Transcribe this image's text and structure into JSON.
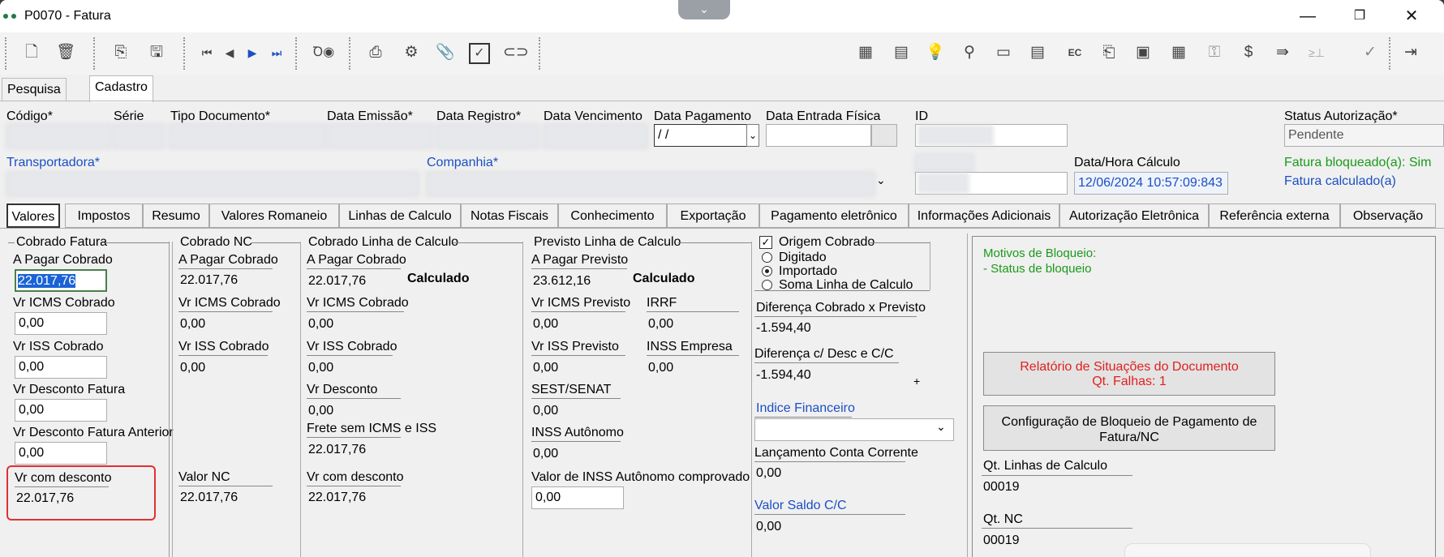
{
  "window": {
    "title": "P0070 - Fatura",
    "minimize": "—",
    "restore": "❐",
    "close": "✕",
    "collapse": "⌄"
  },
  "toolbar": {
    "icons": [
      "new-icon",
      "delete-icon",
      "copy-icon",
      "save-icon",
      "first-icon",
      "prev-icon",
      "next-icon",
      "last-icon",
      "search-binoculars-icon",
      "print-icon",
      "settings-icon",
      "attach-icon",
      "confirm-icon",
      "link-icon",
      "calculator-icon",
      "spreadsheet-icon",
      "bulb-icon",
      "tree-icon",
      "card-icon",
      "document-icon",
      "ec-icon",
      "export-icon",
      "sheet-check-icon",
      "calculator-grid-icon",
      "key-icon",
      "money-icon",
      "transfer-icon",
      "code-icon",
      "check-icon",
      "exit-icon"
    ]
  },
  "tabs_top": [
    "Pesquisa",
    "Cadastro"
  ],
  "header": {
    "codigo_label": "Código*",
    "serie_label": "Série",
    "tipo_label": "Tipo Documento*",
    "emissao_label": "Data Emissão*",
    "registro_label": "Data Registro*",
    "vencimento_label": "Data Vencimento",
    "pagamento_label": "Data Pagamento",
    "pagamento_value": " / /",
    "entrada_label": "Data Entrada Física",
    "id_label": "ID",
    "status_label": "Status Autorização*",
    "status_value": "Pendente",
    "transportadora_label": "Transportadora*",
    "companhia_label": "Companhia*",
    "calculo_label": "Data/Hora Cálculo",
    "calculo_value": "12/06/2024 10:57:09:843",
    "bloqueada_text": "Fatura bloqueado(a): Sim",
    "calculada_text": "Fatura calculado(a)"
  },
  "subtabs": [
    "Valores",
    "Impostos",
    "Resumo",
    "Valores Romaneio",
    "Linhas de Calculo",
    "Notas Fiscais",
    "Conhecimento",
    "Exportação",
    "Pagamento eletrônico",
    "Informações Adicionais",
    "Autorização Eletrônica",
    "Referência externa",
    "Observação"
  ],
  "cobrado_fatura": {
    "title": "Cobrado Fatura",
    "a_pagar_label": "A Pagar Cobrado",
    "a_pagar_value": "22.017,76",
    "icms_label": "Vr ICMS Cobrado",
    "icms_value": "0,00",
    "iss_label": "Vr ISS Cobrado",
    "iss_value": "0,00",
    "desconto_label": "Vr Desconto Fatura",
    "desconto_value": "0,00",
    "desconto_ant_label": "Vr Desconto Fatura Anterior",
    "desconto_ant_value": "0,00",
    "com_desconto_label": "Vr com desconto",
    "com_desconto_value": "22.017,76"
  },
  "cobrado_nc": {
    "title": "Cobrado NC",
    "a_pagar_label": "A Pagar Cobrado",
    "a_pagar_value": "22.017,76",
    "icms_label": "Vr ICMS Cobrado",
    "icms_value": "0,00",
    "iss_label": "Vr ISS Cobrado",
    "iss_value": "0,00",
    "valor_nc_label": "Valor NC",
    "valor_nc_value": "22.017,76"
  },
  "cobrado_linha": {
    "title": "Cobrado Linha de Calculo",
    "a_pagar_label": "A Pagar Cobrado",
    "a_pagar_value": "22.017,76",
    "calculado": "Calculado",
    "icms_label": "Vr ICMS Cobrado",
    "icms_value": "0,00",
    "iss_label": "Vr ISS Cobrado",
    "iss_value": "0,00",
    "desconto_label": "Vr Desconto",
    "desconto_value": "0,00",
    "frete_label": "Frete sem ICMS e ISS",
    "frete_value": "22.017,76",
    "com_desconto_label": "Vr com desconto",
    "com_desconto_value": "22.017,76"
  },
  "previsto_linha": {
    "title": "Previsto Linha de Calculo",
    "a_pagar_label": "A Pagar Previsto",
    "a_pagar_value": "23.612,16",
    "calculado": "Calculado",
    "icms_label": "Vr ICMS Previsto",
    "icms_value": "0,00",
    "irrf_label": "IRRF",
    "irrf_value": "0,00",
    "iss_label": "Vr ISS Previsto",
    "iss_value": "0,00",
    "inss_emp_label": "INSS Empresa",
    "inss_emp_value": "0,00",
    "sest_label": "SEST/SENAT",
    "sest_value": "0,00",
    "inss_aut_label": "INSS Autônomo",
    "inss_aut_value": "0,00",
    "inss_comp_label": "Valor de INSS Autônomo comprovado",
    "inss_comp_value": "0,00"
  },
  "origem": {
    "check_label": "Origem Cobrado",
    "digitado": "Digitado",
    "importado": "Importado",
    "soma": "Soma Linha de Calculo",
    "dif_prev_label": "Diferença Cobrado x Previsto",
    "dif_prev_value": "-1.594,40",
    "dif_desc_label": "Diferença  c/ Desc e C/C",
    "dif_desc_value": "-1.594,40",
    "plus": "+",
    "indice_label": "Indice Financeiro",
    "lanc_label": "Lançamento Conta Corrente",
    "lanc_value": "0,00",
    "saldo_label": "Valor Saldo C/C",
    "saldo_value": "0,00"
  },
  "bloqueio": {
    "motivos_title": "Motivos de Bloqueio:",
    "motivos_item": "- Status de bloqueio",
    "relatorio_line1": "Relatório de Situações do Documento",
    "relatorio_line2": "Qt. Falhas: 1",
    "config_line1": "Configuração de Bloqueio de Pagamento de",
    "config_line2": "Fatura/NC",
    "qt_linhas_label": "Qt. Linhas de Calculo",
    "qt_linhas_value": "00019",
    "qt_nc_label": "Qt. NC",
    "qt_nc_value": "00019"
  },
  "colors": {
    "accent_blue": "#1a4fc4",
    "green": "#1a9a1a",
    "red_text": "#e02020",
    "highlight_red": "#e03030"
  }
}
